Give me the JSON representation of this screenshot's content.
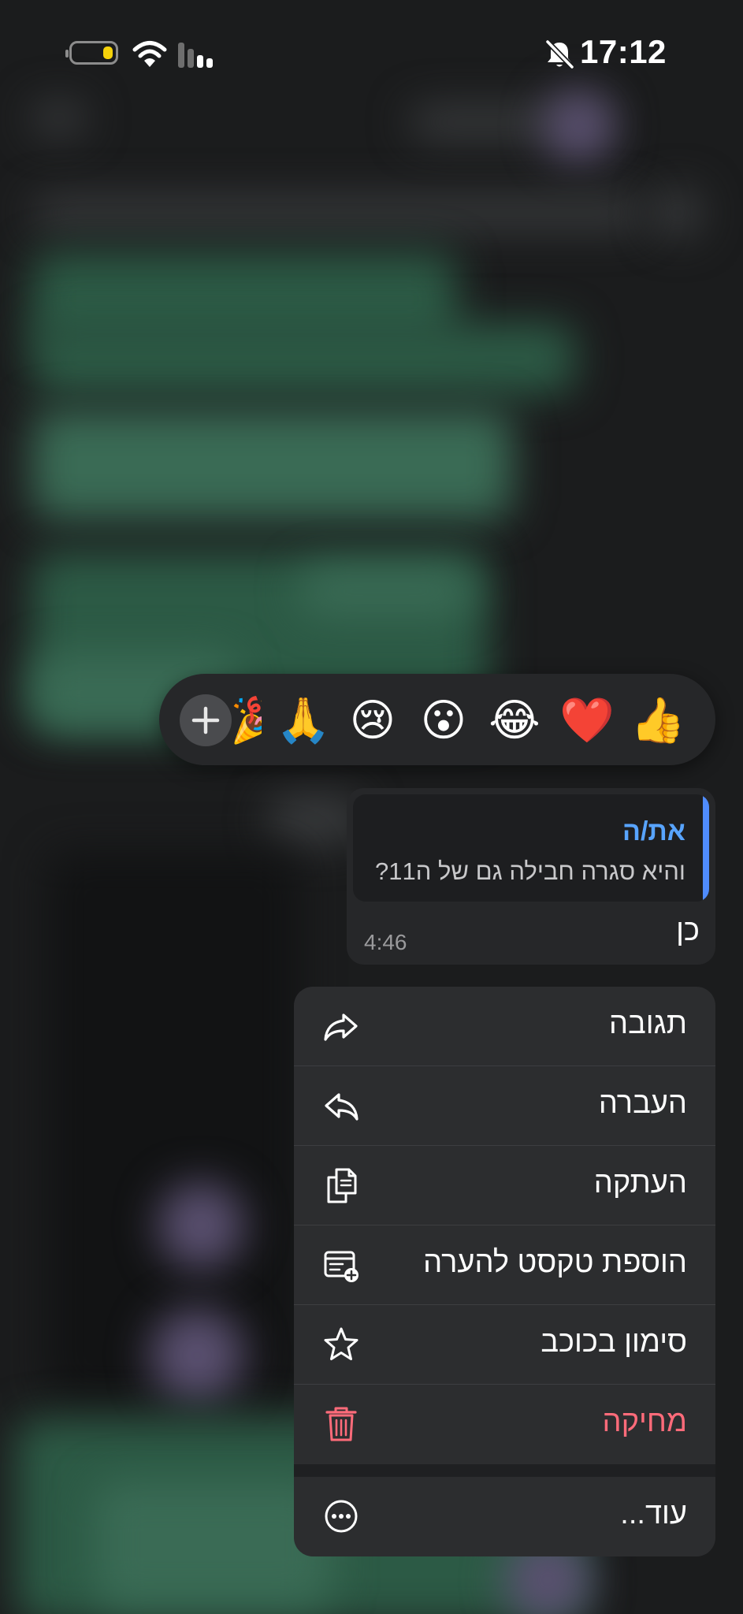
{
  "status_bar": {
    "time": "17:12",
    "battery_icon": "battery-icon",
    "wifi_icon": "wifi-icon",
    "signal_icon": "cellular-signal-icon",
    "mute_icon": "bell-slash-icon"
  },
  "reactions": {
    "add_icon": "plus-icon",
    "items": [
      {
        "emoji": "🎉",
        "name": "party-popper"
      },
      {
        "emoji": "🙏",
        "name": "folded-hands"
      },
      {
        "emoji": "😢",
        "name": "crying-face"
      },
      {
        "emoji": "😮",
        "name": "surprised-face"
      },
      {
        "emoji": "😂",
        "name": "tears-of-joy"
      },
      {
        "emoji": "❤️",
        "name": "red-heart"
      },
      {
        "emoji": "👍",
        "name": "thumbs-up"
      }
    ]
  },
  "message": {
    "quote": {
      "author": "את/ה",
      "text": "והיא סגרה חבילה גם של ה11?"
    },
    "text": "כן",
    "time": "4:46"
  },
  "menu": {
    "items": [
      {
        "label": "תגובה",
        "icon": "share-arrow-icon"
      },
      {
        "label": "העברה",
        "icon": "reply-arrow-icon"
      },
      {
        "label": "העתקה",
        "icon": "copy-icon"
      },
      {
        "label": "הוספת טקסט להערה",
        "icon": "add-note-icon"
      },
      {
        "label": "סימון בכוכב",
        "icon": "star-icon"
      },
      {
        "label": "מחיקה",
        "icon": "trash-icon",
        "color": "#ff6b7a"
      },
      {
        "label": "עוד...",
        "icon": "more-circle-icon"
      }
    ]
  },
  "colors": {
    "accent_blue": "#58a4ff",
    "danger": "#ff6b7a",
    "battery_yellow": "#f5d20a"
  }
}
